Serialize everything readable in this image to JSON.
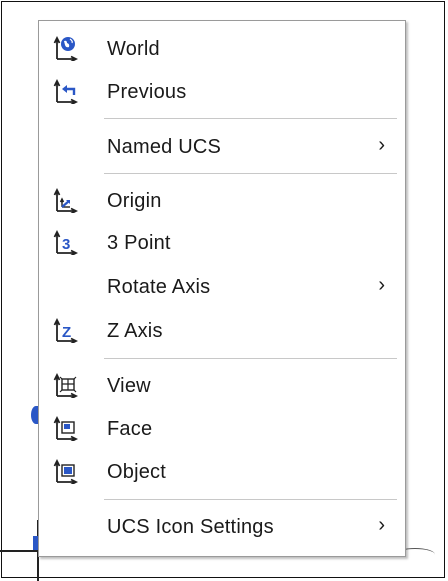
{
  "menu": {
    "items": [
      {
        "label": "World",
        "icon": "ucs-world-icon"
      },
      {
        "label": "Previous",
        "icon": "ucs-previous-icon"
      },
      {
        "label": "Named UCS",
        "submenu_arrow": "›"
      },
      {
        "label": "Origin",
        "icon": "ucs-origin-icon"
      },
      {
        "label": "3 Point",
        "icon": "ucs-3point-icon"
      },
      {
        "label": "Rotate Axis",
        "submenu_arrow": "›"
      },
      {
        "label": "Z Axis",
        "icon": "ucs-zaxis-icon"
      },
      {
        "label": "View",
        "icon": "ucs-view-icon"
      },
      {
        "label": "Face",
        "icon": "ucs-face-icon"
      },
      {
        "label": "Object",
        "icon": "ucs-object-icon"
      },
      {
        "label": "UCS Icon Settings",
        "submenu_arrow": "›"
      }
    ]
  },
  "colors": {
    "icon_blue": "#2a57c6",
    "icon_dark": "#222222",
    "separator": "#c8c8c8",
    "text": "#1a1a1a"
  }
}
